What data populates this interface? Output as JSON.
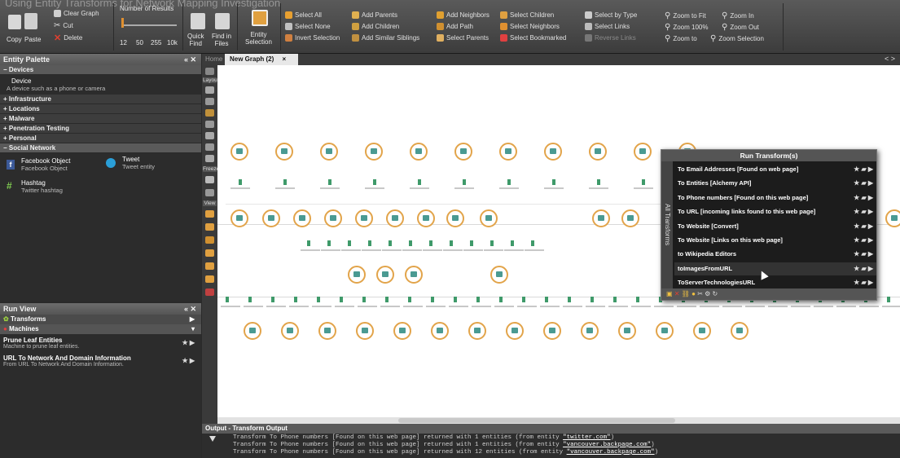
{
  "ribbon": {
    "title": "Using Entity Transforms for Network Mapping Investigation",
    "clear_graph": "Clear Graph",
    "cut": "Cut",
    "delete": "Delete",
    "copy": "Copy",
    "paste": "Paste",
    "number_of_results": "Number of Results",
    "ticks": [
      "12",
      "50",
      "255",
      "10k"
    ],
    "quick_find": "Quick\nFind",
    "find_in_files": "Find in\nFiles",
    "entity_selection": "Entity\nSelection",
    "select_all": "Select All",
    "select_none": "Select None",
    "invert_selection": "Invert Selection",
    "add_parents": "Add Parents",
    "add_children": "Add Children",
    "add_similar_siblings": "Add Similar Siblings",
    "add_neighbors": "Add Neighbors",
    "add_path": "Add Path",
    "select_parents": "Select Parents",
    "select_children": "Select Children",
    "select_neighbors": "Select Neighbors",
    "select_bookmarked": "Select Bookmarked",
    "select_by_type": "Select by Type",
    "select_links": "Select Links",
    "reverse_links": "Reverse Links",
    "zoom_to_fit": "Zoom to Fit",
    "zoom_in": "Zoom In",
    "zoom_100": "Zoom 100%",
    "zoom_out": "Zoom Out",
    "zoom_to": "Zoom to",
    "zoom_selection": "Zoom Selection"
  },
  "palette": {
    "title": "Entity Palette",
    "collapse": "<<",
    "close": "x",
    "categories": [
      {
        "label": "Devices",
        "open": true
      },
      {
        "label": "Infrastructure"
      },
      {
        "label": "Locations"
      },
      {
        "label": "Malware"
      },
      {
        "label": "Penetration Testing"
      },
      {
        "label": "Personal"
      },
      {
        "label": "Social Network",
        "open": true
      }
    ],
    "device": {
      "name": "Device",
      "desc": "A device such as a phone or camera"
    },
    "facebook": {
      "name": "Facebook Object",
      "desc": "Facebook Object"
    },
    "tweet": {
      "name": "Tweet",
      "desc": "Tweet entity"
    },
    "hashtag": {
      "name": "Hashtag",
      "desc": "Twitter hashtag"
    }
  },
  "run_view": {
    "title": "Run View",
    "transforms": "Transforms",
    "machines": "Machines",
    "items": [
      {
        "name": "Prune Leaf Entities",
        "desc": "Machine to prune leaf entities."
      },
      {
        "name": "URL To Network And Domain Information",
        "desc": "From URL To Network And Domain Information."
      }
    ]
  },
  "graph": {
    "tab_home": "Home",
    "tab_active": "New Graph (2)",
    "tab_close": "×",
    "nav": "< >",
    "side_labels": {
      "layout": "Layout",
      "freeze": "Freeze",
      "view": "View"
    }
  },
  "menu": {
    "title": "Run Transform(s)",
    "side": "All Transforms",
    "items": [
      "To Email Addresses [Found on web page]",
      "To Entities [Alchemy API]",
      "To Phone numbers [Found on this web page]",
      "To URL [incoming links found to this web page]",
      "To Website [Convert]",
      "To Website [Links on this web page]",
      "to Wikipedia Editors",
      "toImagesFromURL",
      "ToServerTechnologiesURL"
    ],
    "hover_index": 7
  },
  "output": {
    "title": "Output - Transform Output",
    "lines": [
      {
        "text": "Transform To Phone numbers [Found on this web page] returned with 1 entities (from entity ",
        "entity": "\"twitter.com\"",
        "end": ")"
      },
      {
        "text": "Transform To Phone numbers [Found on this web page] returned with 1 entities (from entity ",
        "entity": "\"vancouver.backpage.com\"",
        "end": ")"
      },
      {
        "text": "Transform To Phone numbers [Found on this web page] returned with 12 entities (from entity ",
        "entity": "\"vancouver.backpage.com\"",
        "end": ")"
      }
    ]
  },
  "colors": {
    "accent": "#e2a44a",
    "node_fill": "#4a9a92",
    "leaf": "#3f9a6a"
  }
}
